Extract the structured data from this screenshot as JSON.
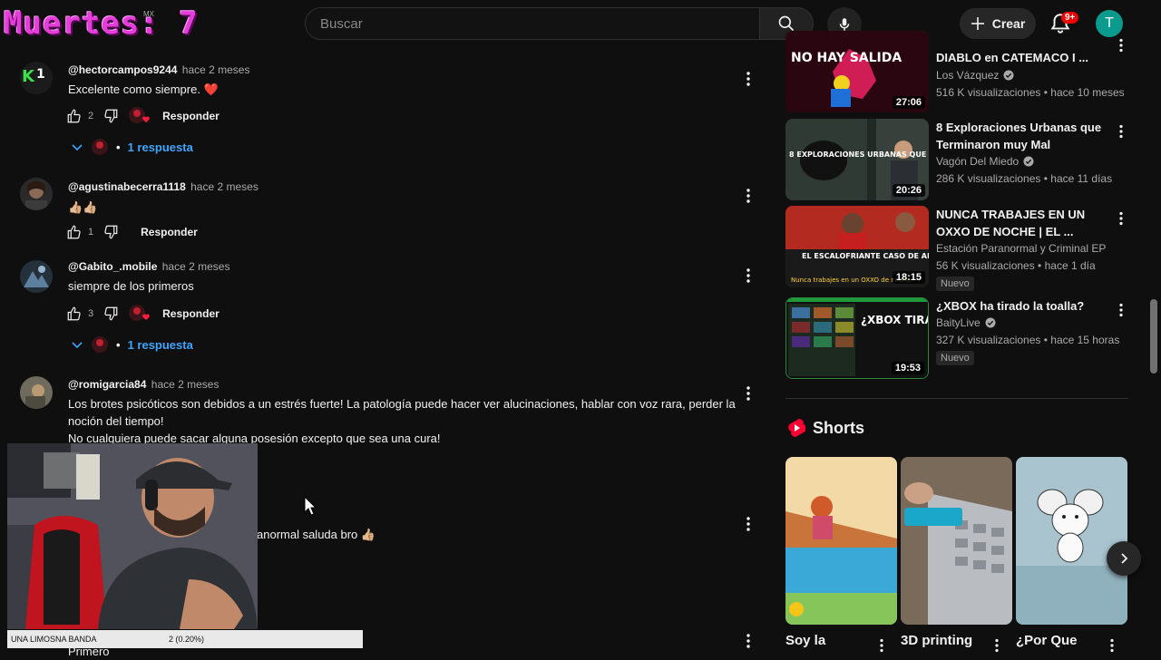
{
  "overlay": {
    "death_counter": "Muertes: 7",
    "country_code": "MX",
    "donation_name": "UNA LIMOSNA BANDA",
    "donation_value": "2 (0.20%)"
  },
  "header": {
    "search_placeholder": "Buscar",
    "create_label": "Crear",
    "notifications_badge": "9+",
    "avatar_letter": "T"
  },
  "comments": [
    {
      "author": "@hectorcampos9244",
      "time": "hace 2 meses",
      "text": "Excelente como siempre. ❤️",
      "likes": "2",
      "reply_label": "Responder",
      "replies_label": "1 respuesta"
    },
    {
      "author": "@agustinabecerra1118",
      "time": "hace 2 meses",
      "text": "👍🏼👍🏼",
      "likes": "1",
      "reply_label": "Responder"
    },
    {
      "author": "@Gabito_.mobile",
      "time": "hace 2 meses",
      "text": "siempre de los primeros",
      "likes": "3",
      "reply_label": "Responder",
      "replies_label": "1 respuesta"
    },
    {
      "author": "@romigarcia84",
      "time": "hace 2 meses",
      "text_lines": [
        "Los brotes psicóticos son debidos a un estrés fuerte! La patología puede hacer ver alucinaciones, hablar con voz rara, perder la",
        "noción del tiempo!",
        "No cualquiera puede sacar alguna posesión excepto que sea una cura!"
      ]
    },
    {
      "partial_text": "anormal saluda bro 👍🏼"
    },
    {
      "partial_text": "Primero"
    }
  ],
  "related_videos": [
    {
      "title": "DIABLO en CATEMACO I ...",
      "thumb_text": "NO HAY SALIDA",
      "channel": "Los Vázquez",
      "verified": true,
      "meta": "516 K visualizaciones • hace 10 meses",
      "duration": "27:06"
    },
    {
      "title": "8 Exploraciones Urbanas que Terminaron muy Mal",
      "thumb_text": "8 EXPLORACIONES URBANAS QUE",
      "channel": "Vagón Del Miedo",
      "verified": true,
      "meta": "286 K visualizaciones • hace 11 días",
      "duration": "20:26"
    },
    {
      "title": "NUNCA TRABAJES EN UN OXXO DE NOCHE | EL ...",
      "thumb_text": "EL ESCALOFRIANTE CASO DE AL",
      "thumb_subtext": "Nunca trabajes en un OXXO de noche",
      "channel": "Estación Paranormal y Criminal EP",
      "verified": false,
      "meta": "56 K visualizaciones • hace 1 día",
      "badge": "Nuevo",
      "duration": "18:15"
    },
    {
      "title": "¿XBOX ha tirado la toalla?",
      "thumb_text": "¿XBOX TIRA LA TOALLA?",
      "channel": "BaityLive",
      "verified": true,
      "meta": "327 K visualizaciones • hace 15 horas",
      "badge": "Nuevo",
      "duration": "19:53"
    }
  ],
  "shorts": {
    "heading": "Shorts",
    "items": [
      {
        "title": "Soy la"
      },
      {
        "title": "3D printing"
      },
      {
        "title": "¿Por Que"
      }
    ]
  },
  "colors": {
    "background": "#0f0f0f",
    "link_blue": "#3ea6ff",
    "shorts_red": "#ff0033",
    "overlay_magenta": "#e43dd8"
  }
}
